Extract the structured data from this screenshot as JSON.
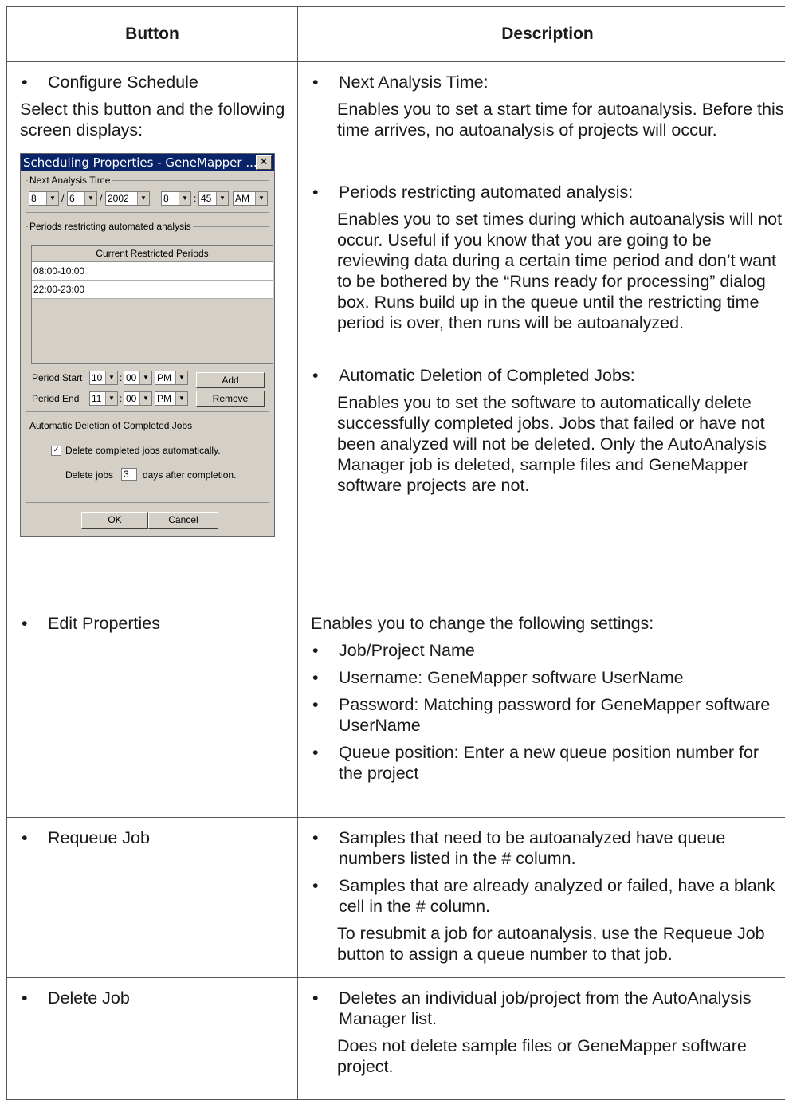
{
  "headers": {
    "button": "Button",
    "description": "Description"
  },
  "rows": {
    "schedule": {
      "button_label": "Configure Schedule",
      "button_note": "Select this button and the following screen displays:",
      "items": [
        {
          "title": "Next Analysis Time:",
          "text": "Enables you to set a start time for autoanalysis. Before this time arrives, no autoanalysis of projects will occur."
        },
        {
          "title": "Periods restricting automated analysis:",
          "text": "Enables you to set times during which autoanalysis will not occur. Useful if you know that you are going to be reviewing data during a certain time period and don’t want to be bothered by the “Runs ready for processing” dialog box. Runs build up in the queue until the restricting time period is over, then runs will be autoanalyzed."
        },
        {
          "title": "Automatic Deletion of Completed Jobs:",
          "text": "Enables you to set the software to automatically delete successfully completed jobs. Jobs that failed or have not been analyzed will not be deleted. Only the AutoAnalysis Manager job is deleted, sample files and GeneMapper software projects are not."
        }
      ]
    },
    "edit": {
      "button_label": "Edit Properties",
      "intro": "Enables you to change the following settings:",
      "items": [
        "Job/Project Name",
        "Username: GeneMapper software UserName",
        "Password: Matching password for GeneMapper software UserName",
        "Queue position: Enter a new queue position number for the project"
      ]
    },
    "requeue": {
      "button_label": "Requeue Job",
      "items": [
        "Samples that need to be autoanalyzed have queue numbers listed in the # column.",
        "Samples that are already analyzed or failed, have a blank cell in the # column."
      ],
      "note": "To resubmit a job for autoanalysis, use the Requeue Job button to assign a queue number to that job."
    },
    "delete": {
      "button_label": "Delete Job",
      "item": "Deletes an individual job/project from the AutoAnalysis Manager list.",
      "note": "Does not delete sample files or GeneMapper software project."
    }
  },
  "dialog": {
    "title": "Scheduling Properties - GeneMapper ...",
    "close": "✕",
    "next_analysis": {
      "legend": "Next Analysis Time",
      "month": "8",
      "day": "6",
      "year": "2002",
      "hour": "8",
      "minute": "45",
      "ampm": "AM",
      "sep_slash": "/",
      "sep_colon": ":"
    },
    "periods": {
      "legend": "Periods restricting automated analysis",
      "list_header": "Current Restricted Periods",
      "list_items": [
        "08:00-10:00",
        "22:00-23:00"
      ],
      "start_label": "Period Start",
      "start_hour": "10",
      "start_min": "00",
      "start_ampm": "PM",
      "end_label": "Period End",
      "end_hour": "11",
      "end_min": "00",
      "end_ampm": "PM",
      "add": "Add",
      "remove": "Remove"
    },
    "deletion": {
      "legend": "Automatic Deletion of Completed Jobs",
      "checkbox_label": "Delete completed jobs automatically.",
      "checkbox_mark": "✓",
      "delete_prefix": "Delete jobs",
      "days": "3",
      "delete_suffix": "days after completion."
    },
    "ok": "OK",
    "cancel": "Cancel",
    "arrow": "▼"
  },
  "bullet": "•"
}
